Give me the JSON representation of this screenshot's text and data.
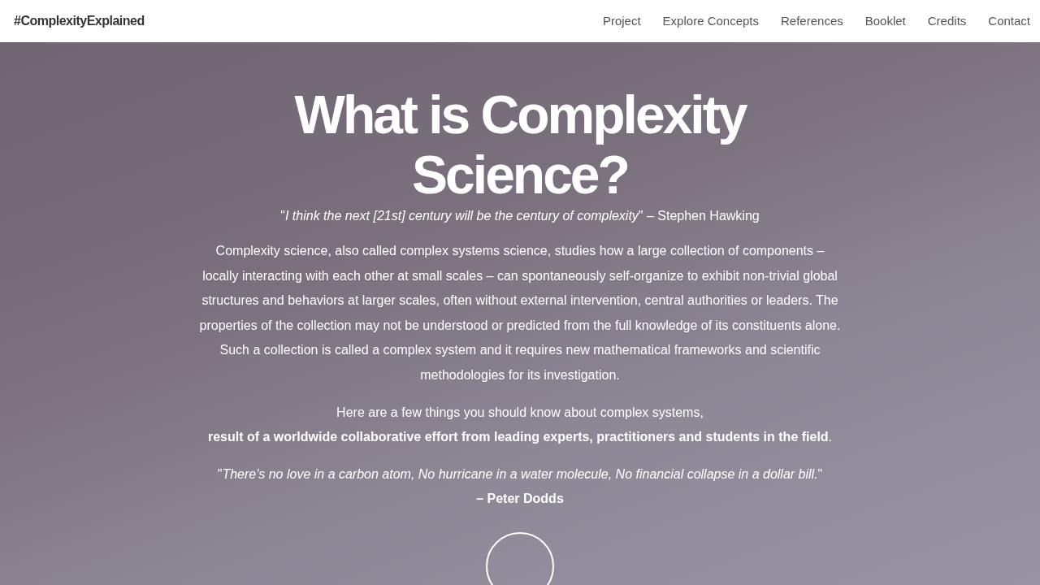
{
  "navbar": {
    "logo": "#ComplexityExplained",
    "links": [
      "Project",
      "Explore Concepts",
      "References",
      "Booklet",
      "Credits",
      "Contact"
    ]
  },
  "hero": {
    "title_lines": [
      "What is Complexity",
      "Science?"
    ],
    "quote": "\"*I think the next [21st] century will be the century of complexity*\" – Stephen Hawking",
    "description": "Complexity science, also called complex systems science, studies how a large collection of components – locally interacting with each other at small scales – can spontaneously self-organize to exhibit non-trivial global structures and behaviors at larger scales, often without external intervention, central authorities or leaders. The properties of the collection may not be understood or predicted from the full knowledge of its constituents alone. Such a collection is called a complex system and it requires new mathematical frameworks and scientific methodologies for its investigation.",
    "intro": "Here are a few things you should know about complex systems,",
    "intro_emphasis": "**result of a worldwide collaborative effort from leading experts, practitioners and students in the field**.",
    "closing_quote": "\"*There's no love in a carbon atom, No hurricane in a water molecule, No financial collapse in a dollar bill.*\"",
    "closing_author": "– Peter Dodds"
  }
}
